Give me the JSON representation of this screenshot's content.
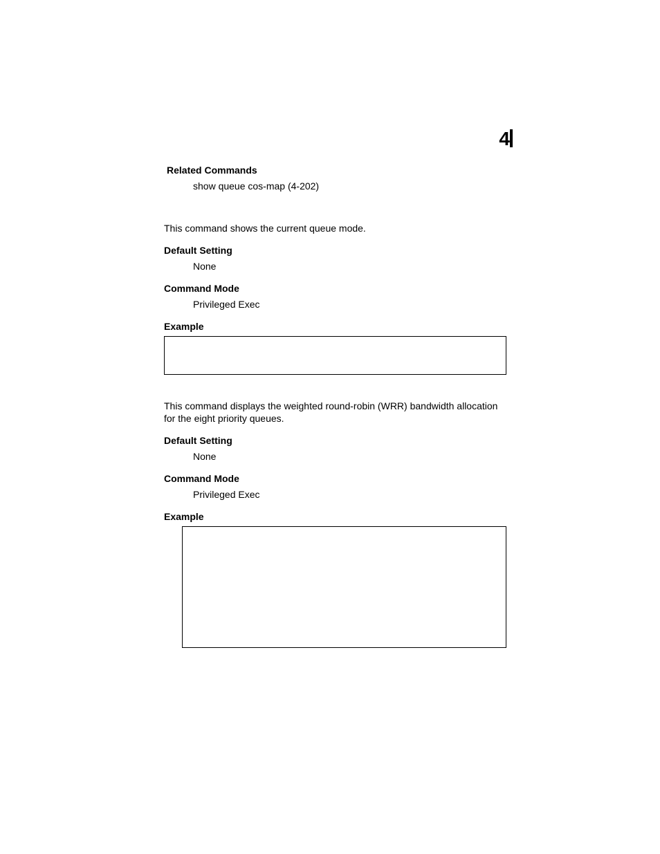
{
  "pageNumberBadge": "4",
  "section1": {
    "relatedCommandsHeading": "Related Commands",
    "relatedCommandsText": "show queue cos-map (4-202)"
  },
  "section2": {
    "description": "This command shows the current queue mode.",
    "defaultSettingHeading": "Default Setting",
    "defaultSettingValue": "None",
    "commandModeHeading": "Command Mode",
    "commandModeValue": "Privileged Exec",
    "exampleHeading": "Example"
  },
  "section3": {
    "description": "This command displays the weighted round-robin (WRR) bandwidth allocation for the eight priority queues.",
    "defaultSettingHeading": "Default Setting",
    "defaultSettingValue": "None",
    "commandModeHeading": "Command Mode",
    "commandModeValue": "Privileged Exec",
    "exampleHeading": "Example"
  }
}
